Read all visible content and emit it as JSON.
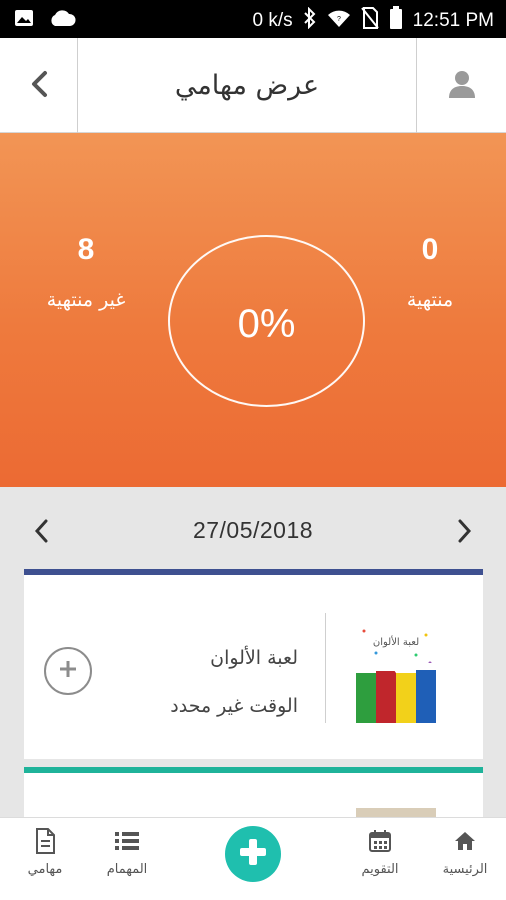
{
  "status_bar": {
    "left_icons": [
      "image-icon",
      "cloud-icon"
    ],
    "net_speed": "0 k/s",
    "right_icons": [
      "bluetooth-icon",
      "wifi-icon",
      "no-sim-icon",
      "battery-icon"
    ],
    "time": "12:51 PM"
  },
  "header": {
    "title": "عرض مهامي",
    "back_icon": "chevron-left-icon",
    "user_icon": "user-icon"
  },
  "stats": {
    "finished_count": "0",
    "finished_label": "منتهية",
    "unfinished_count": "8",
    "unfinished_label": "غير منتهية",
    "progress_text": "0%",
    "gradient_top": "#f29555",
    "gradient_bottom": "#ec6a33"
  },
  "date_nav": {
    "date": "27/05/2018",
    "prev_icon": "chevron-left-icon",
    "next_icon": "chevron-right-icon"
  },
  "tasks": [
    {
      "name": "لعبة الألوان",
      "time": "الوقت غير محدد",
      "thumb_caption": "لعبة الألوان",
      "accent_color": "#3e5090",
      "action_icon": "plus-circle-icon"
    },
    {
      "accent_color": "#1fb39a"
    }
  ],
  "bottom_nav": {
    "items": [
      {
        "label": "الرئيسية",
        "icon": "home-icon"
      },
      {
        "label": "التقويم",
        "icon": "calendar-icon"
      },
      {
        "label": "المهمام",
        "icon": "list-icon"
      },
      {
        "label": "مهامي",
        "icon": "document-icon"
      }
    ],
    "fab_icon": "plus-icon",
    "fab_color": "#1fbfae"
  }
}
